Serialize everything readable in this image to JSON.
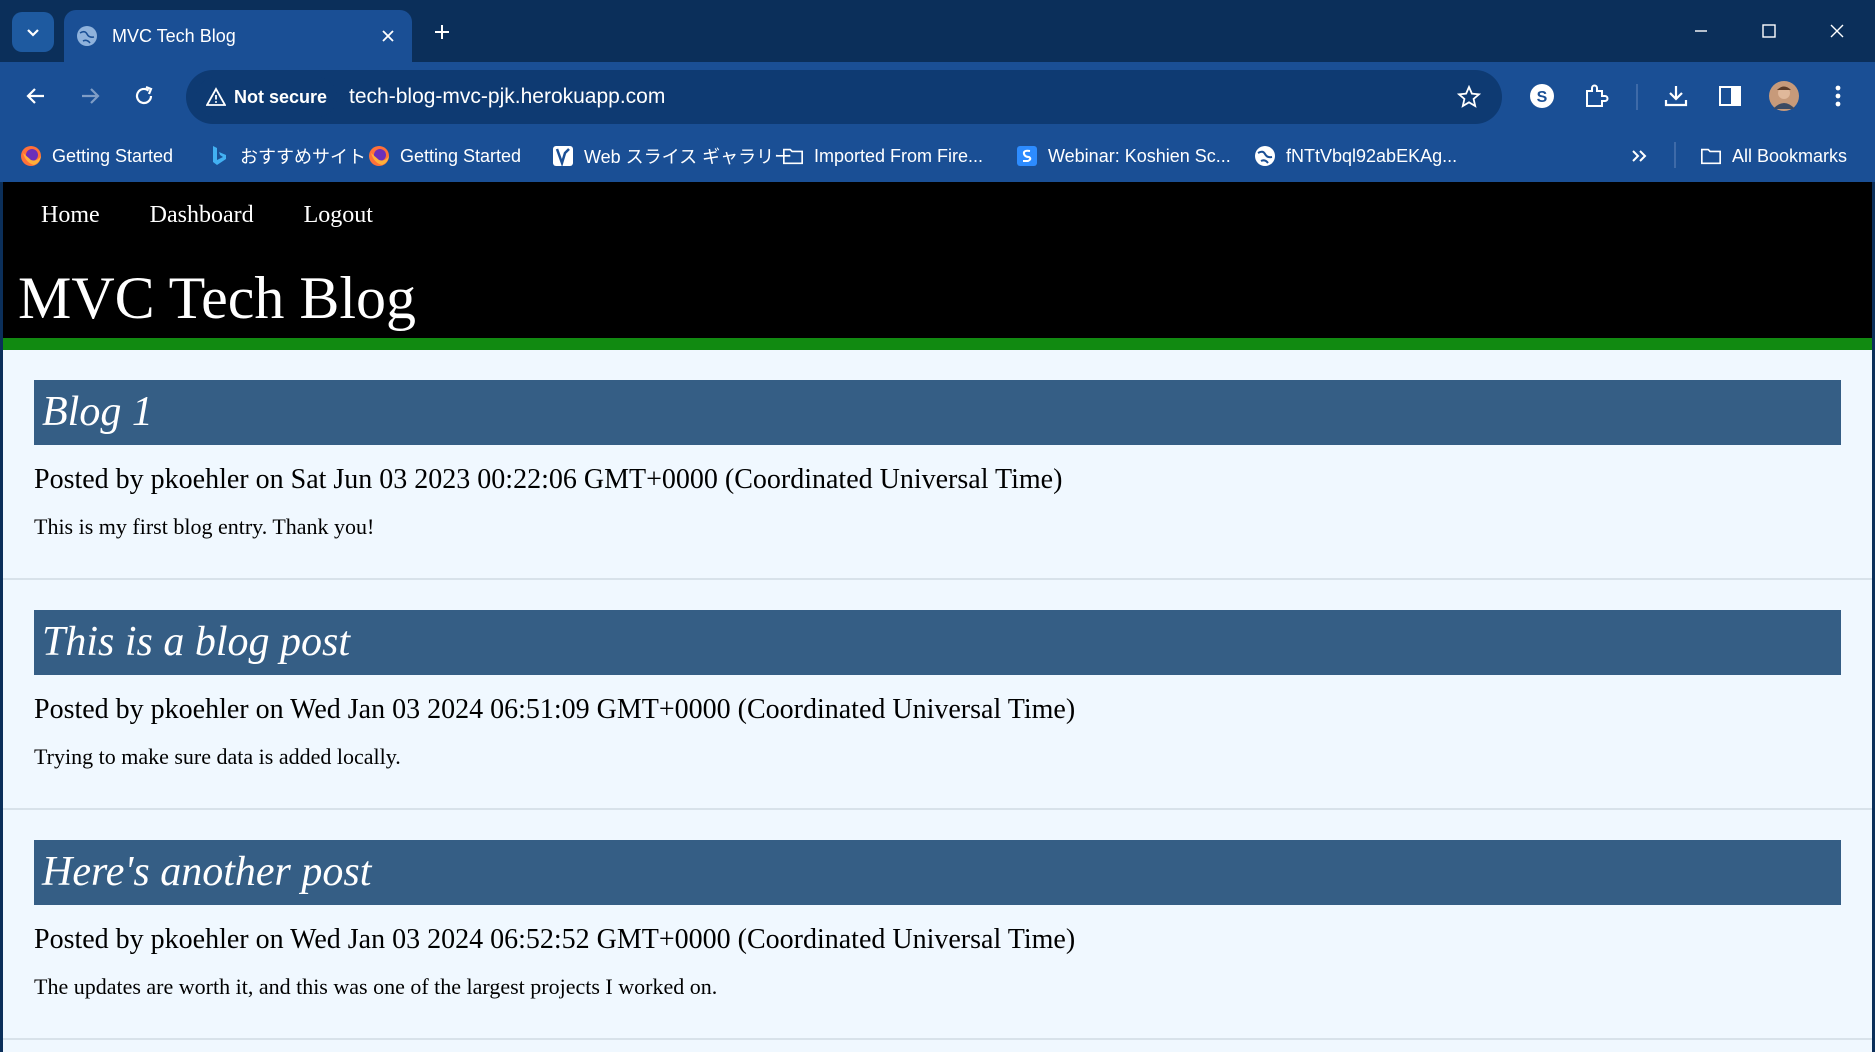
{
  "browser": {
    "tab_title": "MVC Tech Blog",
    "security_label": "Not secure",
    "url": "tech-blog-mvc-pjk.herokuapp.com",
    "accent": "#1a4f95",
    "bookmarks": [
      {
        "label": "Getting Started",
        "icon": "firefox-icon"
      },
      {
        "label": "おすすめサイト",
        "icon": "bing-icon"
      },
      {
        "label": "Getting Started",
        "icon": "firefox-icon"
      },
      {
        "label": "Web スライス ギャラリー",
        "icon": "web-slice-icon"
      },
      {
        "label": "Imported From Fire...",
        "icon": "folder-icon"
      },
      {
        "label": "Webinar: Koshien Sc...",
        "icon": "webinar-icon"
      },
      {
        "label": "fNTtVbql92abEKAg...",
        "icon": "globe-icon"
      }
    ],
    "all_bookmarks": "All Bookmarks"
  },
  "site": {
    "nav": {
      "home": "Home",
      "dashboard": "Dashboard",
      "logout": "Logout"
    },
    "title": "MVC Tech Blog",
    "header_bg": "#000000",
    "header_border": "#118a11",
    "post_title_bg": "#355e85",
    "page_bg": "#f0f8ff"
  },
  "posts": [
    {
      "title": "Blog 1",
      "meta": "Posted by pkoehler on Sat Jun 03 2023 00:22:06 GMT+0000 (Coordinated Universal Time)",
      "body": "This is my first blog entry. Thank you!"
    },
    {
      "title": "This is a blog post",
      "meta": "Posted by pkoehler on Wed Jan 03 2024 06:51:09 GMT+0000 (Coordinated Universal Time)",
      "body": "Trying to make sure data is added locally."
    },
    {
      "title": "Here's another post",
      "meta": "Posted by pkoehler on Wed Jan 03 2024 06:52:52 GMT+0000 (Coordinated Universal Time)",
      "body": "The updates are worth it, and this was one of the largest projects I worked on."
    }
  ]
}
